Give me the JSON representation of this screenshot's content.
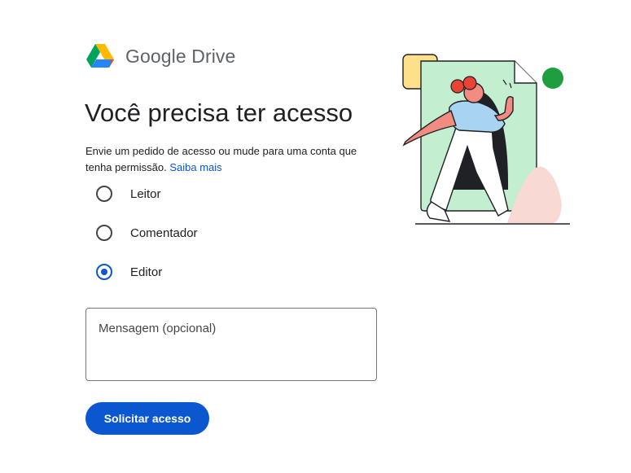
{
  "brand": {
    "name": "Google Drive",
    "logo_icon": "google-drive-logo"
  },
  "header": {
    "title": "Você precisa ter acesso"
  },
  "description": {
    "text": "Envie um pedido de acesso ou mude para uma conta que tenha permissão.",
    "link_label": "Saiba mais"
  },
  "roles": {
    "selected": "Editor",
    "options": [
      {
        "label": "Leitor",
        "checked": false
      },
      {
        "label": "Comentador",
        "checked": false
      },
      {
        "label": "Editor",
        "checked": true
      }
    ]
  },
  "message": {
    "placeholder": "Mensagem (opcional)",
    "value": ""
  },
  "actions": {
    "submit_label": "Solicitar acesso"
  },
  "colors": {
    "accent": "#0b57d0",
    "text": "#202124",
    "brand_gray": "#5f6368",
    "illustration_green": "#c4eed0",
    "illustration_yellow": "#ffe08a",
    "illustration_pink": "#f9d9d3",
    "illustration_red": "#ea4335",
    "illustration_blue": "#a8d4f2",
    "dot_green": "#1e9e3e"
  }
}
